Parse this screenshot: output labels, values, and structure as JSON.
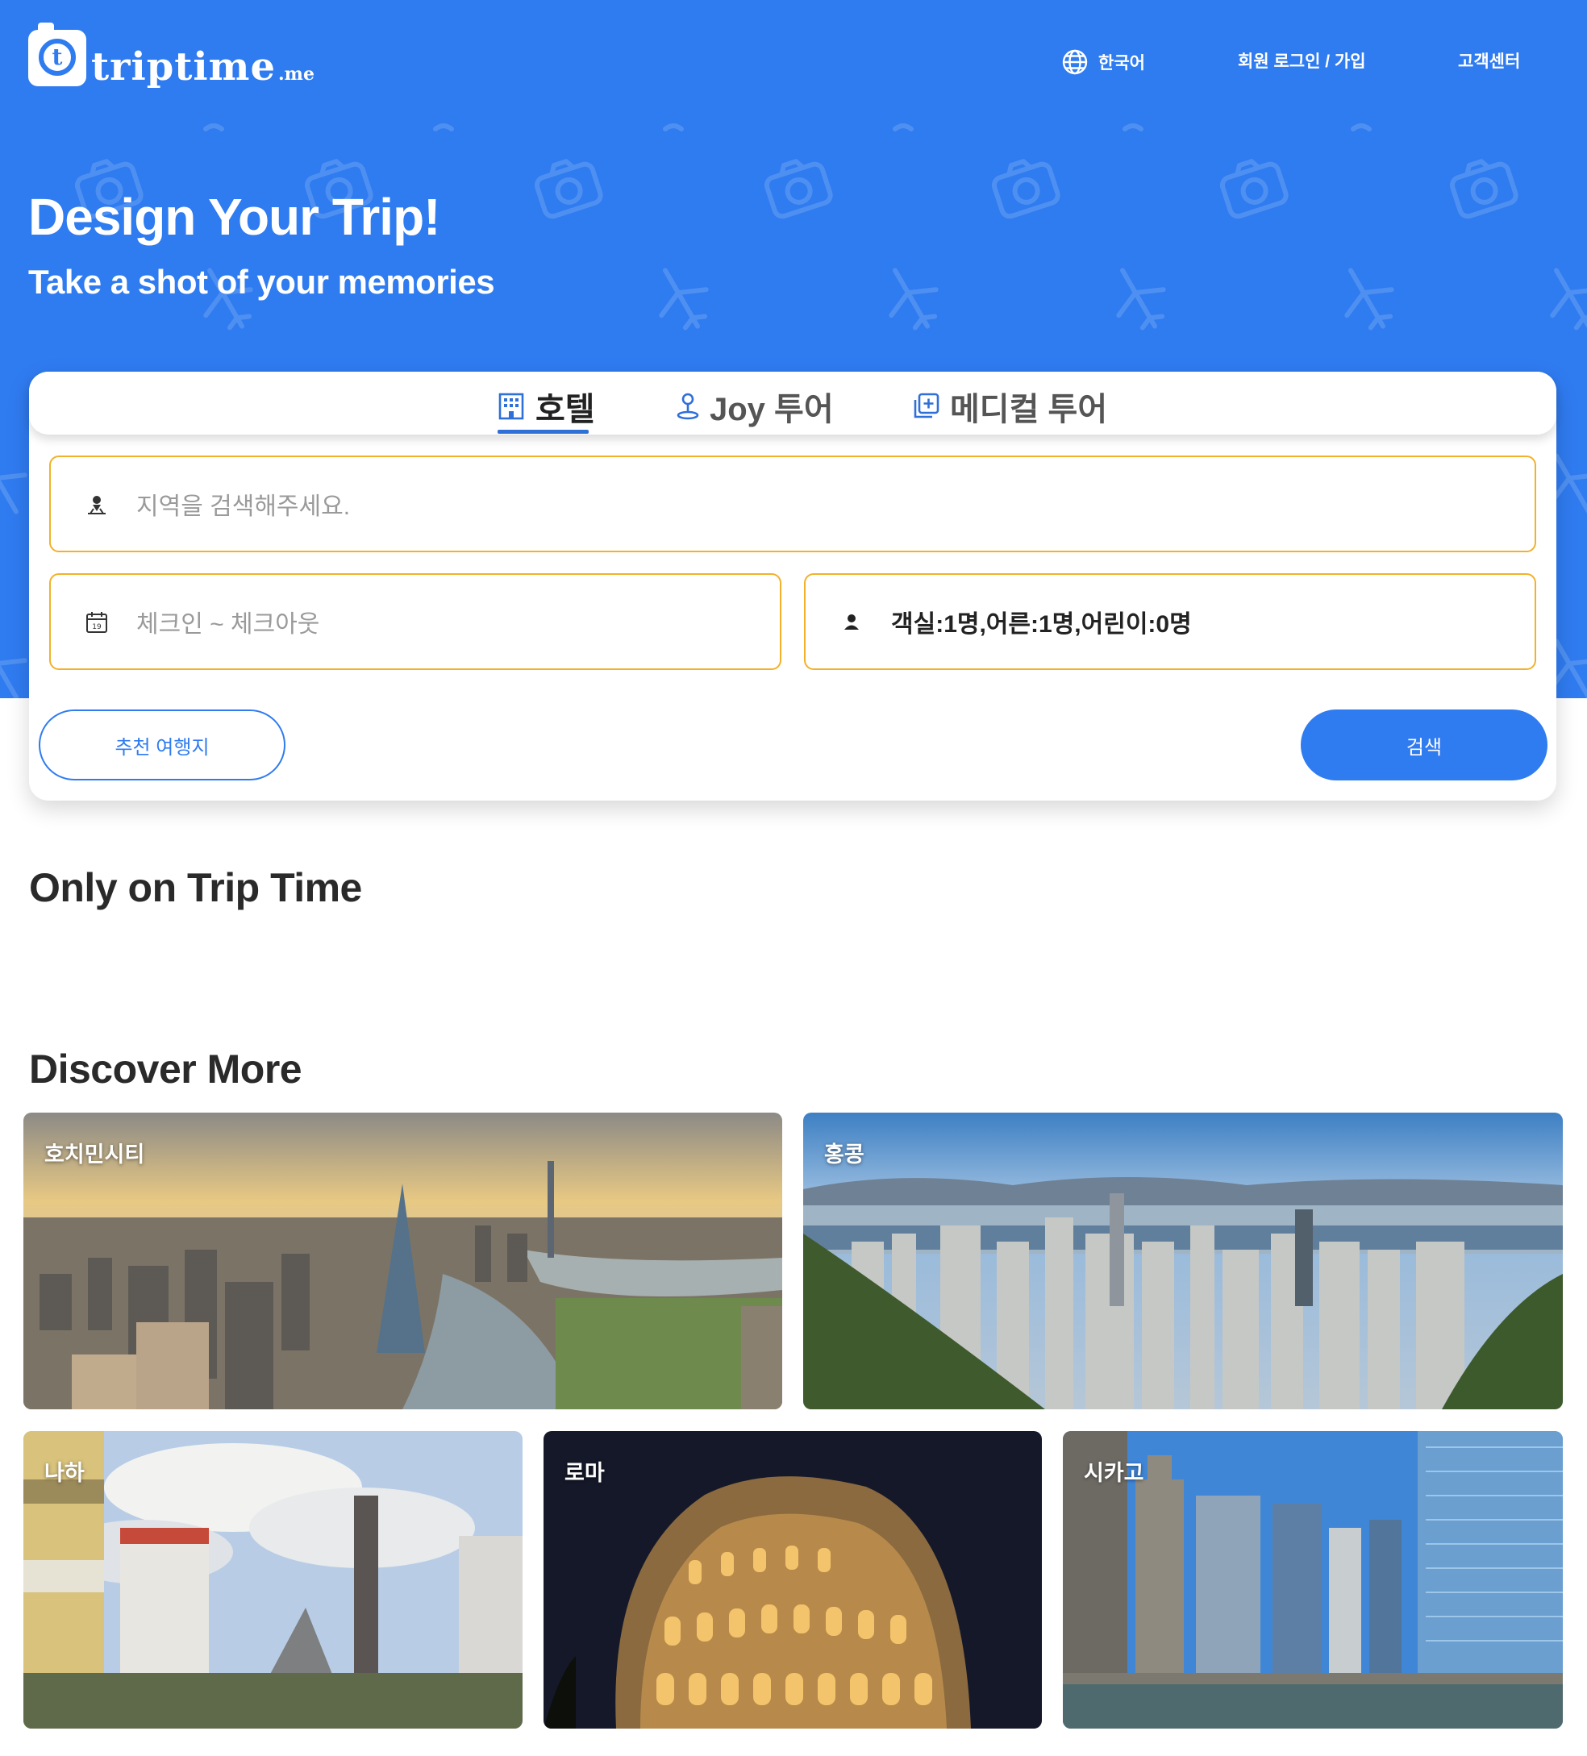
{
  "brand": {
    "name": "triptime",
    "tld": ".me",
    "logo_letter": "t"
  },
  "header": {
    "language": "한국어",
    "login": "회원 로그인 / 가입",
    "help": "고객센터"
  },
  "hero": {
    "title": "Design Your Trip!",
    "subtitle": "Take a shot of your memories"
  },
  "search": {
    "tabs": [
      {
        "label": "호텔",
        "icon": "hotel-building-icon",
        "active": true
      },
      {
        "label": "Joy 투어",
        "icon": "map-pin-person-icon",
        "active": false
      },
      {
        "label": "메디컬 투어",
        "icon": "medical-plus-icon",
        "active": false
      }
    ],
    "region_placeholder": "지역을 검색해주세요.",
    "dates_placeholder": "체크인 ~ 체크아웃",
    "calendar_day": "19",
    "guests_value": "객실:1명,어른:1명,어린이:0명",
    "recommend_button": "추천 여행지",
    "search_button": "검색"
  },
  "sections": {
    "only": "Only on Trip Time",
    "discover": "Discover More"
  },
  "destinations": [
    {
      "name": "호치민시티"
    },
    {
      "name": "홍콩"
    },
    {
      "name": "나하"
    },
    {
      "name": "로마"
    },
    {
      "name": "시카고"
    }
  ],
  "colors": {
    "primary": "#2f7bf0",
    "field_border": "#f2b12a",
    "tab_underline": "#2e6fd8"
  }
}
